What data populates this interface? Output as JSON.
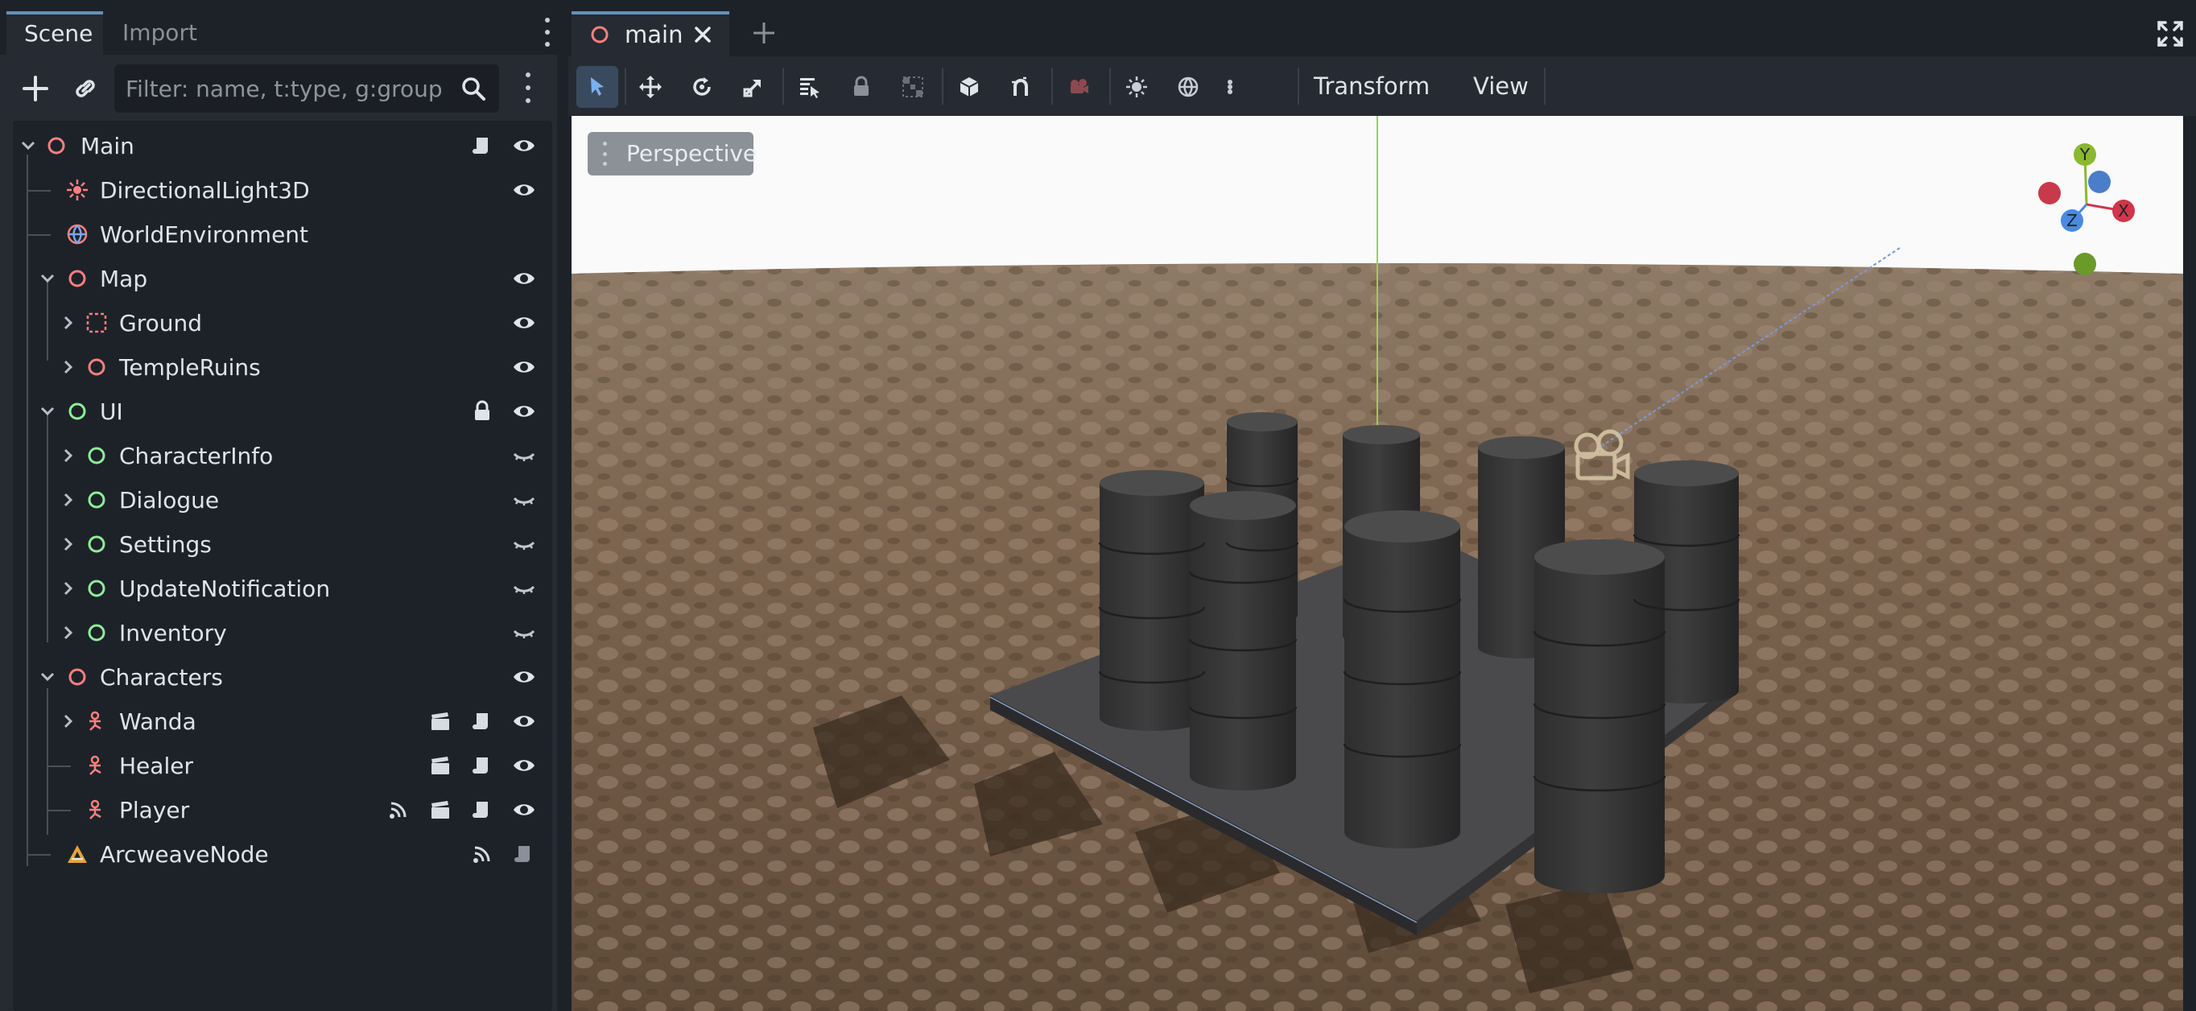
{
  "dock": {
    "tabs": [
      {
        "label": "Scene",
        "active": true
      },
      {
        "label": "Import",
        "active": false
      }
    ],
    "filter": {
      "placeholder": "Filter: name, t:type, g:group",
      "value": ""
    }
  },
  "tree": [
    {
      "label": "Main",
      "icon": "node3d-icon",
      "color": "#fc7f7f"
    },
    {
      "label": "DirectionalLight3D",
      "icon": "directional-light-icon",
      "color": "#fc7f7f"
    },
    {
      "label": "WorldEnvironment",
      "icon": "world-environment-icon",
      "color": "#fc7f7f"
    },
    {
      "label": "Map",
      "icon": "node3d-icon",
      "color": "#fc7f7f"
    },
    {
      "label": "Ground",
      "icon": "gridmap-icon",
      "color": "#fc7f7f"
    },
    {
      "label": "TempleRuins",
      "icon": "node3d-icon",
      "color": "#fc7f7f"
    },
    {
      "label": "UI",
      "icon": "control-icon",
      "color": "#8eef97"
    },
    {
      "label": "CharacterInfo",
      "icon": "control-icon",
      "color": "#8eef97"
    },
    {
      "label": "Dialogue",
      "icon": "control-icon",
      "color": "#8eef97"
    },
    {
      "label": "Settings",
      "icon": "control-icon",
      "color": "#8eef97"
    },
    {
      "label": "UpdateNotification",
      "icon": "control-icon",
      "color": "#8eef97"
    },
    {
      "label": "Inventory",
      "icon": "control-icon",
      "color": "#8eef97"
    },
    {
      "label": "Characters",
      "icon": "node3d-icon",
      "color": "#fc7f7f"
    },
    {
      "label": "Wanda",
      "icon": "skeleton-character-icon",
      "color": "#fc7f7f"
    },
    {
      "label": "Healer",
      "icon": "skeleton-character-icon",
      "color": "#fc7f7f"
    },
    {
      "label": "Player",
      "icon": "skeleton-character-icon",
      "color": "#fc7f7f"
    },
    {
      "label": "ArcweaveNode",
      "icon": "arcweave-icon",
      "color": "#e8a23a"
    }
  ],
  "editor": {
    "scene_tab": "main",
    "menus": {
      "transform": "Transform",
      "view": "View"
    },
    "viewport": {
      "perspective": "Perspective"
    },
    "gizmo": {
      "x": "X",
      "y": "Y",
      "z": "Z"
    }
  },
  "colors": {
    "accent": "#6690b8",
    "node3d": "#fc7f7f",
    "control": "#8eef97",
    "panel": "#262b33",
    "background": "#1d2229"
  }
}
